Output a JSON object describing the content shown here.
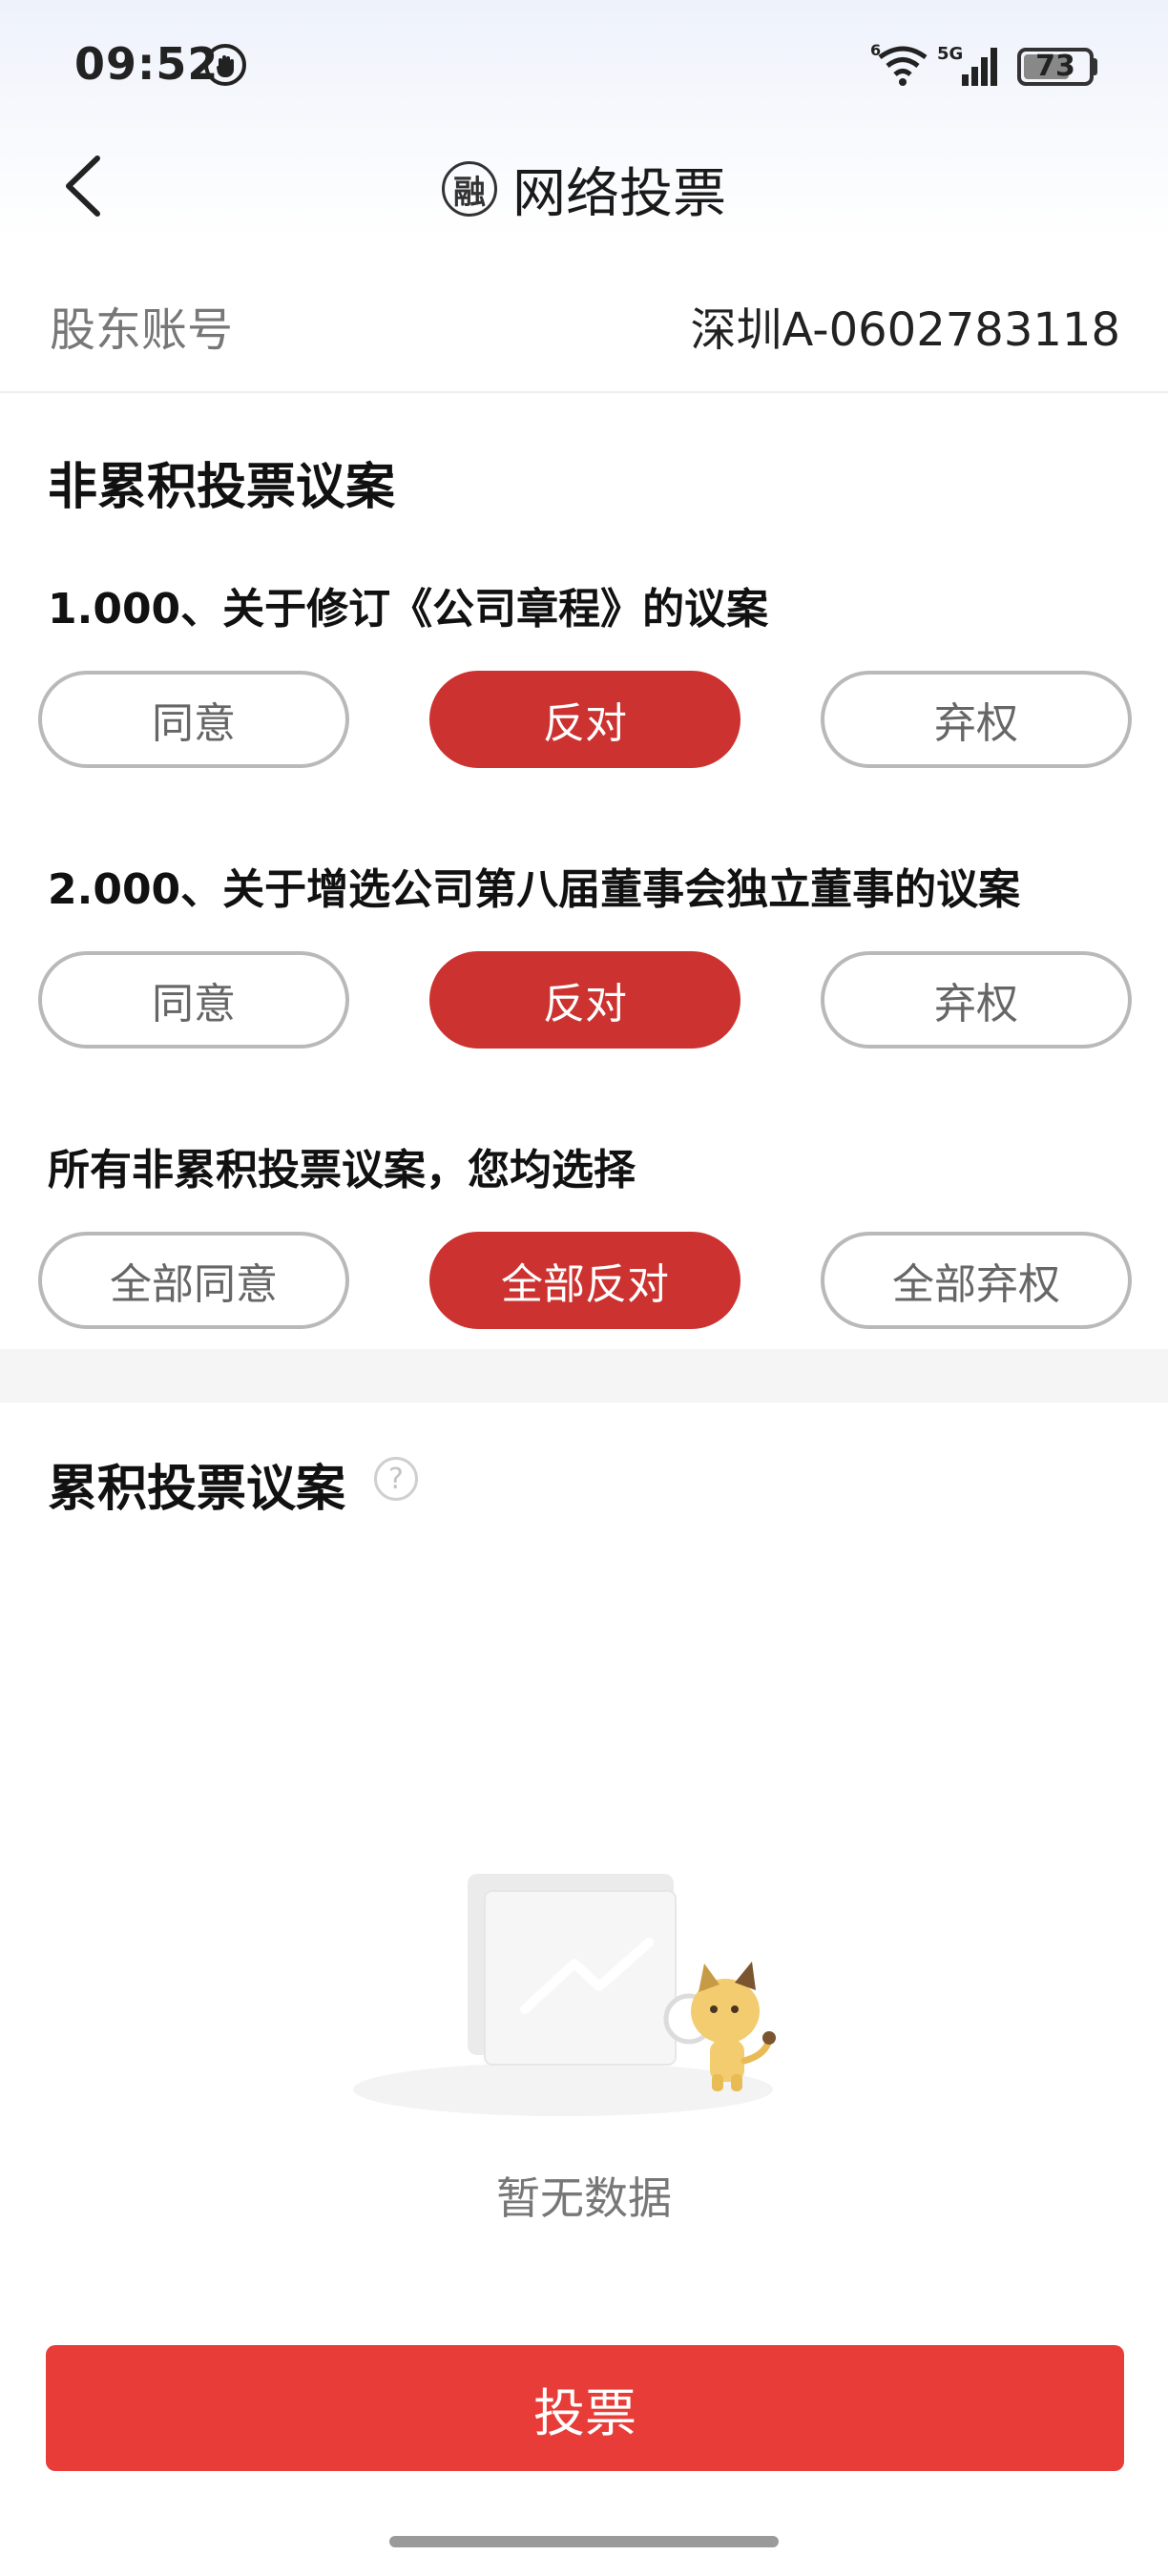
{
  "status_bar": {
    "time": "09:52",
    "battery": "73",
    "battery_level": 0.73,
    "network": "5G"
  },
  "header": {
    "title": "网络投票",
    "brand_glyph": "融"
  },
  "account": {
    "label": "股东账号",
    "value": "深圳A-0602783118"
  },
  "non_cumulative": {
    "section_title": "非累积投票议案",
    "motions": [
      {
        "title": "1.000、关于修订《公司章程》的议案",
        "options": [
          "同意",
          "反对",
          "弃权"
        ],
        "selected": "反对"
      },
      {
        "title": "2.000、关于增选公司第八届董事会独立董事的议案",
        "options": [
          "同意",
          "反对",
          "弃权"
        ],
        "selected": "反对"
      }
    ],
    "bulk_title": "所有非累积投票议案，您均选择",
    "bulk_options": [
      "全部同意",
      "全部反对",
      "全部弃权"
    ],
    "bulk_selected": "全部反对"
  },
  "cumulative": {
    "section_title": "累积投票议案",
    "help_glyph": "?",
    "empty_text": "暂无数据"
  },
  "vote_button": "投票",
  "colors": {
    "accent": "#cc3230",
    "button": "#e83c38"
  }
}
